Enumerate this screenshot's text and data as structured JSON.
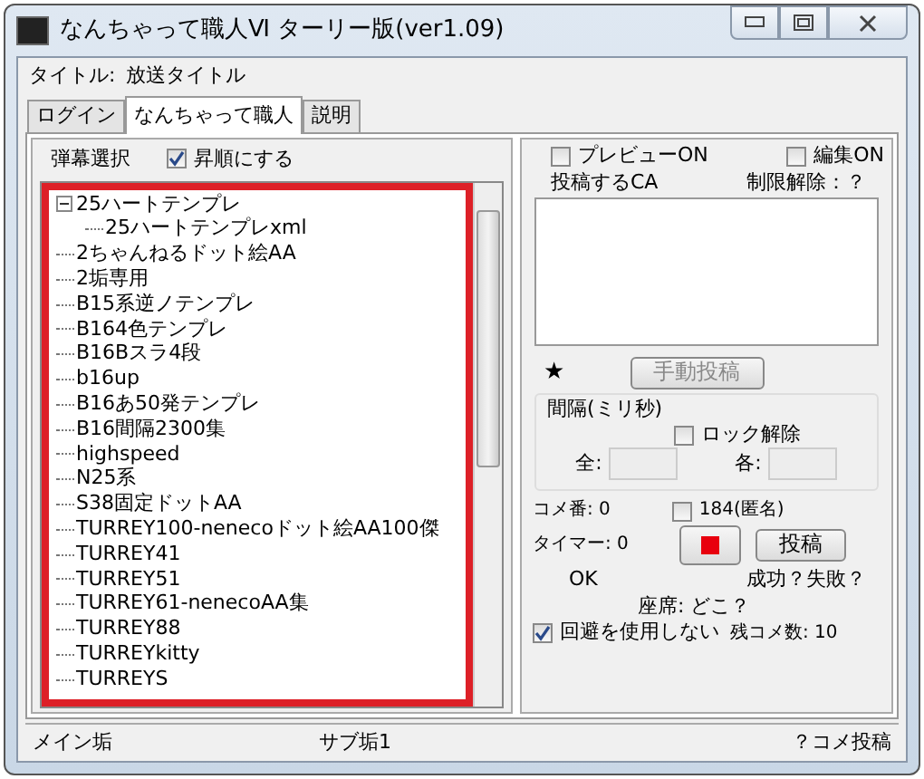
{
  "window": {
    "title": "なんちゃって職人Ⅵ ターリー版(ver1.09)"
  },
  "title_field": {
    "label": "タイトル:",
    "value": "放送タイトル"
  },
  "tabs": [
    {
      "label": "ログイン",
      "selected": false
    },
    {
      "label": "なんちゃって職人",
      "selected": true
    },
    {
      "label": "説明",
      "selected": false
    }
  ],
  "left": {
    "label": "弾幕選択",
    "sort_checkbox": {
      "label": "昇順にする",
      "checked": true
    },
    "tree": [
      {
        "label": "25ハートテンプレ",
        "expanded": true,
        "children": [
          {
            "label": "25ハートテンプレxml"
          }
        ]
      },
      {
        "label": "2ちゃんねるドット絵AA"
      },
      {
        "label": "2垢専用"
      },
      {
        "label": "B15系逆ノテンプレ"
      },
      {
        "label": "B164色テンプレ"
      },
      {
        "label": "B16Bスラ4段"
      },
      {
        "label": "b16up"
      },
      {
        "label": "B16あ50発テンプレ"
      },
      {
        "label": "B16間隔2300集"
      },
      {
        "label": "highspeed"
      },
      {
        "label": "N25系"
      },
      {
        "label": "S38固定ドットAA"
      },
      {
        "label": "TURREY100-nenecoドット絵AA100傑"
      },
      {
        "label": "TURREY41"
      },
      {
        "label": "TURREY51"
      },
      {
        "label": "TURREY61-nenecoAA集"
      },
      {
        "label": "TURREY88"
      },
      {
        "label": "TURREYkitty"
      },
      {
        "label": "TURREYS"
      }
    ]
  },
  "right": {
    "preview": {
      "label": "プレビューON",
      "checked": false
    },
    "edit": {
      "label": "編集ON",
      "checked": false
    },
    "ca_label": "投稿するCA",
    "limit": "制限解除：？",
    "star": "★",
    "manual_button": {
      "label": "手動投稿",
      "disabled": true
    },
    "interval": {
      "label": "間隔(ミリ秒)",
      "lock": {
        "label": "ロック解除",
        "checked": false
      },
      "all_label": "全:",
      "each_label": "各:"
    },
    "comment_no": "コメ番:  0",
    "anon": {
      "label": "184(匿名)",
      "checked": false
    },
    "timer": "タイマー:  0",
    "post_button": "投稿",
    "ok": "OK",
    "result": "成功？失敗？",
    "seat": "座席:  どこ？",
    "avoid": {
      "label": "回避を使用しない",
      "checked": true
    },
    "remaining": "残コメ数:  10"
  },
  "status_bar": [
    "メイン垢",
    "サブ垢1",
    "？コメ投稿"
  ]
}
